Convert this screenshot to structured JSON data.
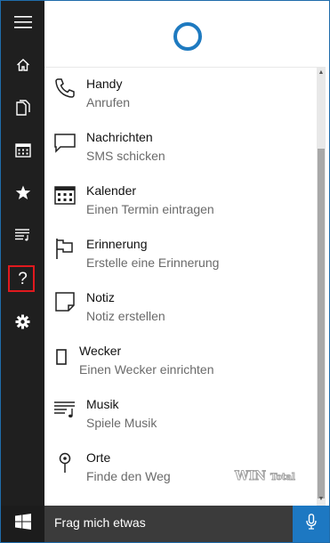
{
  "accent_color": "#1e7ac0",
  "highlight_color": "#e0191e",
  "rail": {
    "items": [
      {
        "name": "menu",
        "icon": "hamburger-icon"
      },
      {
        "name": "home",
        "icon": "home-icon"
      },
      {
        "name": "notebook",
        "icon": "notebook-icon"
      },
      {
        "name": "reminders",
        "icon": "calendar-icon"
      },
      {
        "name": "favorites",
        "icon": "star-icon"
      },
      {
        "name": "music",
        "icon": "music-list-icon"
      },
      {
        "name": "help",
        "icon": "help-icon",
        "glyph": "?",
        "highlighted": true
      },
      {
        "name": "settings",
        "icon": "gear-icon"
      }
    ]
  },
  "header": {
    "cortana_icon": "cortana-circle-icon"
  },
  "suggestions": [
    {
      "title": "Handy",
      "subtitle": "Anrufen",
      "icon": "phone-icon"
    },
    {
      "title": "Nachrichten",
      "subtitle": "SMS schicken",
      "icon": "message-icon"
    },
    {
      "title": "Kalender",
      "subtitle": "Einen Termin eintragen",
      "icon": "calendar-icon"
    },
    {
      "title": "Erinnerung",
      "subtitle": "Erstelle eine Erinnerung",
      "icon": "flag-icon"
    },
    {
      "title": "Notiz",
      "subtitle": "Notiz erstellen",
      "icon": "note-icon"
    },
    {
      "title": "Wecker",
      "subtitle": "Einen Wecker einrichten",
      "icon": "alarm-icon"
    },
    {
      "title": "Musik",
      "subtitle": "Spiele Musik",
      "icon": "music-icon"
    },
    {
      "title": "Orte",
      "subtitle": "Finde den Weg",
      "icon": "location-pin-icon"
    }
  ],
  "watermark": {
    "text_main": "WIN",
    "text_small": "Total"
  },
  "search": {
    "placeholder": "Frag mich etwas"
  },
  "taskbar": {
    "start_icon": "windows-logo-icon",
    "mic_icon": "microphone-icon"
  }
}
